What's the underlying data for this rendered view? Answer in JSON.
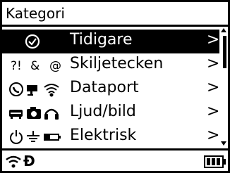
{
  "header": {
    "title": "Kategori"
  },
  "menu": {
    "items": [
      {
        "label": "Tidigare",
        "chevron": ">",
        "icons": [
          "clock-icon"
        ],
        "selected": true
      },
      {
        "label": "Skiljetecken",
        "chevron": ">",
        "icon_text": [
          "?!",
          "&",
          "@"
        ],
        "selected": false
      },
      {
        "label": "Dataport",
        "chevron": ">",
        "icons": [
          "phone-icon",
          "camera-icon",
          "wifi-icon"
        ],
        "selected": false
      },
      {
        "label": "Ljud/bild",
        "chevron": ">",
        "icons": [
          "projector-icon",
          "photo-camera-icon",
          "headphones-icon"
        ],
        "selected": false
      },
      {
        "label": "Elektrisk",
        "chevron": ">",
        "icons": [
          "power-icon",
          "ground-icon",
          "battery-icon"
        ],
        "selected": false
      }
    ]
  },
  "footer": {
    "status_letter": "Đ",
    "icons": [
      "wifi-status-icon",
      "battery-status-icon"
    ]
  },
  "colors": {
    "foreground": "#000000",
    "background": "#ffffff"
  }
}
